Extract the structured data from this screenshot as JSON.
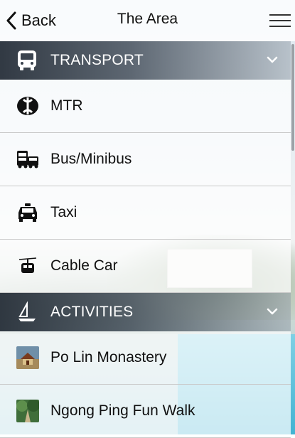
{
  "navbar": {
    "back_label": "Back",
    "title": "The Area"
  },
  "sections": [
    {
      "label": "TRANSPORT",
      "icon": "bus-icon",
      "items": [
        {
          "label": "MTR",
          "icon": "mtr-logo-icon"
        },
        {
          "label": "Bus/Minibus",
          "icon": "bus-minibus-icon"
        },
        {
          "label": "Taxi",
          "icon": "taxi-icon"
        },
        {
          "label": "Cable Car",
          "icon": "cable-car-icon"
        }
      ]
    },
    {
      "label": "ACTIVITIES",
      "icon": "sailboat-icon",
      "items": [
        {
          "label": "Po Lin Monastery",
          "icon": "monastery-thumbnail"
        },
        {
          "label": "Ngong Ping Fun Walk",
          "icon": "fun-walk-thumbnail"
        }
      ]
    }
  ],
  "colors": {
    "section_dark": "#28303a",
    "accent_pool": "#42b3d2"
  }
}
